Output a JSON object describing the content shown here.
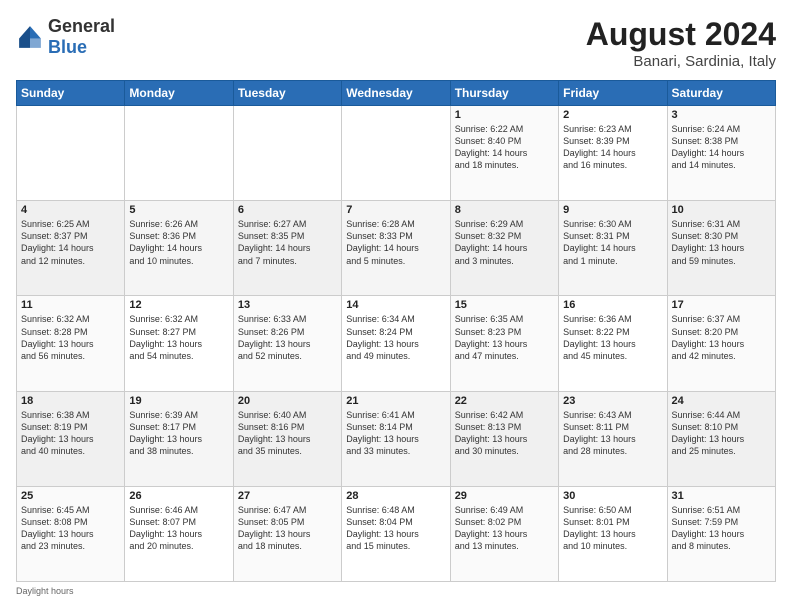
{
  "header": {
    "logo": {
      "general": "General",
      "blue": "Blue"
    },
    "month_year": "August 2024",
    "location": "Banari, Sardinia, Italy"
  },
  "weekdays": [
    "Sunday",
    "Monday",
    "Tuesday",
    "Wednesday",
    "Thursday",
    "Friday",
    "Saturday"
  ],
  "weeks": [
    [
      {
        "day": "",
        "info": ""
      },
      {
        "day": "",
        "info": ""
      },
      {
        "day": "",
        "info": ""
      },
      {
        "day": "",
        "info": ""
      },
      {
        "day": "1",
        "info": "Sunrise: 6:22 AM\nSunset: 8:40 PM\nDaylight: 14 hours\nand 18 minutes."
      },
      {
        "day": "2",
        "info": "Sunrise: 6:23 AM\nSunset: 8:39 PM\nDaylight: 14 hours\nand 16 minutes."
      },
      {
        "day": "3",
        "info": "Sunrise: 6:24 AM\nSunset: 8:38 PM\nDaylight: 14 hours\nand 14 minutes."
      }
    ],
    [
      {
        "day": "4",
        "info": "Sunrise: 6:25 AM\nSunset: 8:37 PM\nDaylight: 14 hours\nand 12 minutes."
      },
      {
        "day": "5",
        "info": "Sunrise: 6:26 AM\nSunset: 8:36 PM\nDaylight: 14 hours\nand 10 minutes."
      },
      {
        "day": "6",
        "info": "Sunrise: 6:27 AM\nSunset: 8:35 PM\nDaylight: 14 hours\nand 7 minutes."
      },
      {
        "day": "7",
        "info": "Sunrise: 6:28 AM\nSunset: 8:33 PM\nDaylight: 14 hours\nand 5 minutes."
      },
      {
        "day": "8",
        "info": "Sunrise: 6:29 AM\nSunset: 8:32 PM\nDaylight: 14 hours\nand 3 minutes."
      },
      {
        "day": "9",
        "info": "Sunrise: 6:30 AM\nSunset: 8:31 PM\nDaylight: 14 hours\nand 1 minute."
      },
      {
        "day": "10",
        "info": "Sunrise: 6:31 AM\nSunset: 8:30 PM\nDaylight: 13 hours\nand 59 minutes."
      }
    ],
    [
      {
        "day": "11",
        "info": "Sunrise: 6:32 AM\nSunset: 8:28 PM\nDaylight: 13 hours\nand 56 minutes."
      },
      {
        "day": "12",
        "info": "Sunrise: 6:32 AM\nSunset: 8:27 PM\nDaylight: 13 hours\nand 54 minutes."
      },
      {
        "day": "13",
        "info": "Sunrise: 6:33 AM\nSunset: 8:26 PM\nDaylight: 13 hours\nand 52 minutes."
      },
      {
        "day": "14",
        "info": "Sunrise: 6:34 AM\nSunset: 8:24 PM\nDaylight: 13 hours\nand 49 minutes."
      },
      {
        "day": "15",
        "info": "Sunrise: 6:35 AM\nSunset: 8:23 PM\nDaylight: 13 hours\nand 47 minutes."
      },
      {
        "day": "16",
        "info": "Sunrise: 6:36 AM\nSunset: 8:22 PM\nDaylight: 13 hours\nand 45 minutes."
      },
      {
        "day": "17",
        "info": "Sunrise: 6:37 AM\nSunset: 8:20 PM\nDaylight: 13 hours\nand 42 minutes."
      }
    ],
    [
      {
        "day": "18",
        "info": "Sunrise: 6:38 AM\nSunset: 8:19 PM\nDaylight: 13 hours\nand 40 minutes."
      },
      {
        "day": "19",
        "info": "Sunrise: 6:39 AM\nSunset: 8:17 PM\nDaylight: 13 hours\nand 38 minutes."
      },
      {
        "day": "20",
        "info": "Sunrise: 6:40 AM\nSunset: 8:16 PM\nDaylight: 13 hours\nand 35 minutes."
      },
      {
        "day": "21",
        "info": "Sunrise: 6:41 AM\nSunset: 8:14 PM\nDaylight: 13 hours\nand 33 minutes."
      },
      {
        "day": "22",
        "info": "Sunrise: 6:42 AM\nSunset: 8:13 PM\nDaylight: 13 hours\nand 30 minutes."
      },
      {
        "day": "23",
        "info": "Sunrise: 6:43 AM\nSunset: 8:11 PM\nDaylight: 13 hours\nand 28 minutes."
      },
      {
        "day": "24",
        "info": "Sunrise: 6:44 AM\nSunset: 8:10 PM\nDaylight: 13 hours\nand 25 minutes."
      }
    ],
    [
      {
        "day": "25",
        "info": "Sunrise: 6:45 AM\nSunset: 8:08 PM\nDaylight: 13 hours\nand 23 minutes."
      },
      {
        "day": "26",
        "info": "Sunrise: 6:46 AM\nSunset: 8:07 PM\nDaylight: 13 hours\nand 20 minutes."
      },
      {
        "day": "27",
        "info": "Sunrise: 6:47 AM\nSunset: 8:05 PM\nDaylight: 13 hours\nand 18 minutes."
      },
      {
        "day": "28",
        "info": "Sunrise: 6:48 AM\nSunset: 8:04 PM\nDaylight: 13 hours\nand 15 minutes."
      },
      {
        "day": "29",
        "info": "Sunrise: 6:49 AM\nSunset: 8:02 PM\nDaylight: 13 hours\nand 13 minutes."
      },
      {
        "day": "30",
        "info": "Sunrise: 6:50 AM\nSunset: 8:01 PM\nDaylight: 13 hours\nand 10 minutes."
      },
      {
        "day": "31",
        "info": "Sunrise: 6:51 AM\nSunset: 7:59 PM\nDaylight: 13 hours\nand 8 minutes."
      }
    ]
  ],
  "footer": {
    "daylight_label": "Daylight hours"
  }
}
